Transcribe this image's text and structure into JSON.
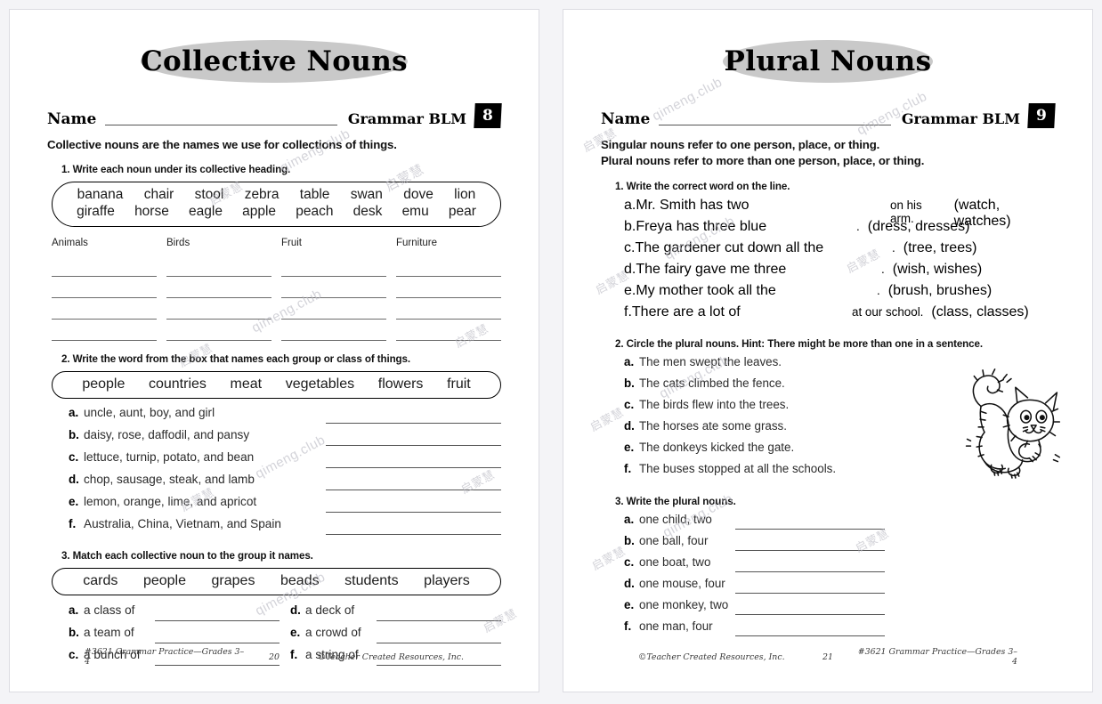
{
  "watermark": {
    "latin": "qimeng.club",
    "cjk": "启蒙慧"
  },
  "pages": [
    {
      "title": "Collective Nouns",
      "name_label": "Name",
      "blm_label": "Grammar BLM",
      "blm_number": "8",
      "intro": [
        "Collective nouns are the names we use for collections of things."
      ],
      "exercises": [
        {
          "number": "1.",
          "instruction": "Write each noun under its collective heading.",
          "word_box_rows": [
            [
              "banana",
              "chair",
              "stool",
              "zebra",
              "table",
              "swan",
              "dove",
              "lion"
            ],
            [
              "giraffe",
              "horse",
              "eagle",
              "apple",
              "peach",
              "desk",
              "emu",
              "pear"
            ]
          ],
          "categories": [
            "Animals",
            "Birds",
            "Fruit",
            "Furniture"
          ],
          "lines_per_category": 4
        },
        {
          "number": "2.",
          "instruction": "Write the word from the box that names each group or class of things.",
          "word_box": [
            "people",
            "countries",
            "meat",
            "vegetables",
            "flowers",
            "fruit"
          ],
          "items": [
            {
              "letter": "a.",
              "text": "uncle, aunt, boy, and girl"
            },
            {
              "letter": "b.",
              "text": "daisy, rose, daffodil, and pansy"
            },
            {
              "letter": "c.",
              "text": "lettuce, turnip, potato, and bean"
            },
            {
              "letter": "d.",
              "text": "chop, sausage, steak, and lamb"
            },
            {
              "letter": "e.",
              "text": "lemon, orange, lime, and apricot"
            },
            {
              "letter": "f.",
              "text": "Australia, China, Vietnam, and Spain"
            }
          ]
        },
        {
          "number": "3.",
          "instruction": "Match each collective noun to the group it names.",
          "word_box": [
            "cards",
            "people",
            "grapes",
            "beads",
            "students",
            "players"
          ],
          "items_left": [
            {
              "letter": "a.",
              "text": "a class of"
            },
            {
              "letter": "b.",
              "text": "a team of"
            },
            {
              "letter": "c.",
              "text": "a bunch of"
            }
          ],
          "items_right": [
            {
              "letter": "d.",
              "text": "a deck of"
            },
            {
              "letter": "e.",
              "text": "a crowd of"
            },
            {
              "letter": "f.",
              "text": "a string of"
            }
          ]
        }
      ],
      "footer": {
        "left": "#3621 Grammar Practice—Grades 3–4",
        "middle": "20",
        "right": "©Teacher Created Resources, Inc."
      }
    },
    {
      "title": "Plural Nouns",
      "name_label": "Name",
      "blm_label": "Grammar BLM",
      "blm_number": "9",
      "intro": [
        "Singular nouns refer to one person, place, or thing.",
        "Plural nouns refer to more than one person, place, or thing."
      ],
      "exercises": [
        {
          "number": "1.",
          "instruction": "Write the correct word on the line.",
          "items": [
            {
              "letter": "a.",
              "pre": "Mr. Smith has two",
              "post": "on his arm.",
              "options": "(watch, watches)"
            },
            {
              "letter": "b.",
              "pre": "Freya has three blue",
              "post": ".",
              "options": "(dress, dresses)"
            },
            {
              "letter": "c.",
              "pre": "The gardener cut down all the",
              "post": ".",
              "options": "(tree, trees)"
            },
            {
              "letter": "d.",
              "pre": "The fairy gave me three",
              "post": ".",
              "options": "(wish, wishes)"
            },
            {
              "letter": "e.",
              "pre": "My mother took all the",
              "post": ".",
              "options": "(brush, brushes)"
            },
            {
              "letter": "f.",
              "pre": "There are a lot of",
              "post": "at our school.",
              "options": "(class, classes)"
            }
          ]
        },
        {
          "number": "2.",
          "instruction": "Circle the plural nouns.  Hint: There might be more than one in a sentence.",
          "items": [
            {
              "letter": "a.",
              "text": "The men swept the leaves."
            },
            {
              "letter": "b.",
              "text": "The cats climbed the fence."
            },
            {
              "letter": "c.",
              "text": "The birds flew into the trees."
            },
            {
              "letter": "d.",
              "text": "The horses ate some grass."
            },
            {
              "letter": "e.",
              "text": "The donkeys kicked the gate."
            },
            {
              "letter": "f.",
              "text": "The buses stopped at all the schools."
            }
          ],
          "illustration": "cat-illustration"
        },
        {
          "number": "3.",
          "instruction": "Write the plural nouns.",
          "items": [
            {
              "letter": "a.",
              "text": "one child, two"
            },
            {
              "letter": "b.",
              "text": "one ball, four"
            },
            {
              "letter": "c.",
              "text": "one boat, two"
            },
            {
              "letter": "d.",
              "text": "one mouse, four"
            },
            {
              "letter": "e.",
              "text": "one monkey, two"
            },
            {
              "letter": "f.",
              "text": "one man, four"
            }
          ]
        }
      ],
      "footer": {
        "left": "©Teacher Created Resources, Inc.",
        "middle": "21",
        "right": "#3621 Grammar Practice—Grades 3–4"
      }
    }
  ]
}
